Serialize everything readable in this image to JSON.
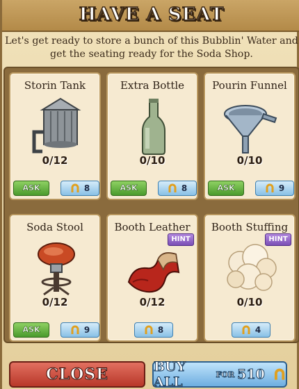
{
  "dialog": {
    "title": "HAVE A SEAT",
    "subtitle": "Let's get ready to store a bunch of this Bubblin' Water and get the seating ready for the Soda Shop."
  },
  "items": [
    {
      "name": "Storin Tank",
      "count": "0/12",
      "ask": "ASK",
      "price": "8",
      "icon": "storage-tank-icon"
    },
    {
      "name": "Extra Bottle",
      "count": "0/10",
      "ask": "ASK",
      "price": "8",
      "icon": "bottle-icon"
    },
    {
      "name": "Pourin Funnel",
      "count": "0/10",
      "ask": "ASK",
      "price": "9",
      "icon": "funnel-icon"
    },
    {
      "name": "Soda Stool",
      "count": "0/12",
      "ask": "ASK",
      "price": "9",
      "icon": "stool-icon"
    },
    {
      "name": "Booth Leather",
      "count": "0/12",
      "hint": "HINT",
      "price": "8",
      "icon": "leather-icon"
    },
    {
      "name": "Booth Stuffing",
      "count": "0/10",
      "hint": "HINT",
      "price": "4",
      "icon": "stuffing-icon"
    }
  ],
  "footer": {
    "close_label": "CLOSE",
    "buy_all_label": "BUY ALL",
    "buy_for": "FOR",
    "buy_total": "510"
  },
  "colors": {
    "ask_green": "#4a9a2c",
    "price_blue": "#88c0e6",
    "hint_purple": "#7a4eb5",
    "close_red": "#b8382a"
  }
}
